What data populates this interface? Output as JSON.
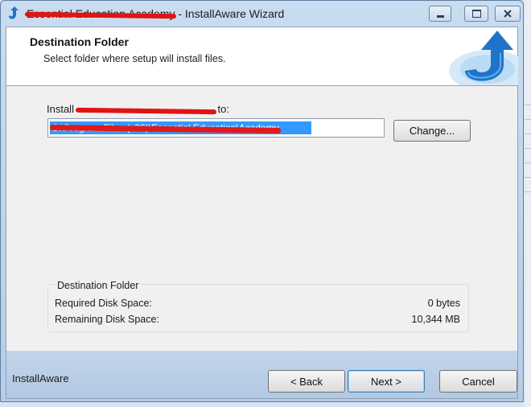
{
  "window": {
    "title_redacted": "Essential Education Academy",
    "title_suffix": " - InstallAware Wizard",
    "controls": {
      "minimize": "—",
      "maximize": "□",
      "close": "✕"
    }
  },
  "header": {
    "title": "Destination Folder",
    "subtitle": "Select folder where setup will install files."
  },
  "install": {
    "prefix": "Install ",
    "product_redacted": "Essential Education Academy",
    "suffix": " to:",
    "path_value": "C:\\Program Files (x86)\\Essential Education\\Academy",
    "change_label": "Change..."
  },
  "disk": {
    "group_title": "Destination Folder",
    "required_label": "Required Disk Space:",
    "required_value": "0 bytes",
    "remaining_label": "Remaining Disk Space:",
    "remaining_value": "10,344 MB"
  },
  "footer": {
    "brand": "InstallAware",
    "back_label": "< Back",
    "next_label": "Next >",
    "cancel_label": "Cancel"
  },
  "colors": {
    "accent": "#3399ff",
    "redaction": "#e11414",
    "logo_blue": "#1f74c9"
  },
  "icons": [
    "installaware-app-icon",
    "installaware-logo-icon",
    "minimize-icon",
    "maximize-icon",
    "close-icon"
  ]
}
